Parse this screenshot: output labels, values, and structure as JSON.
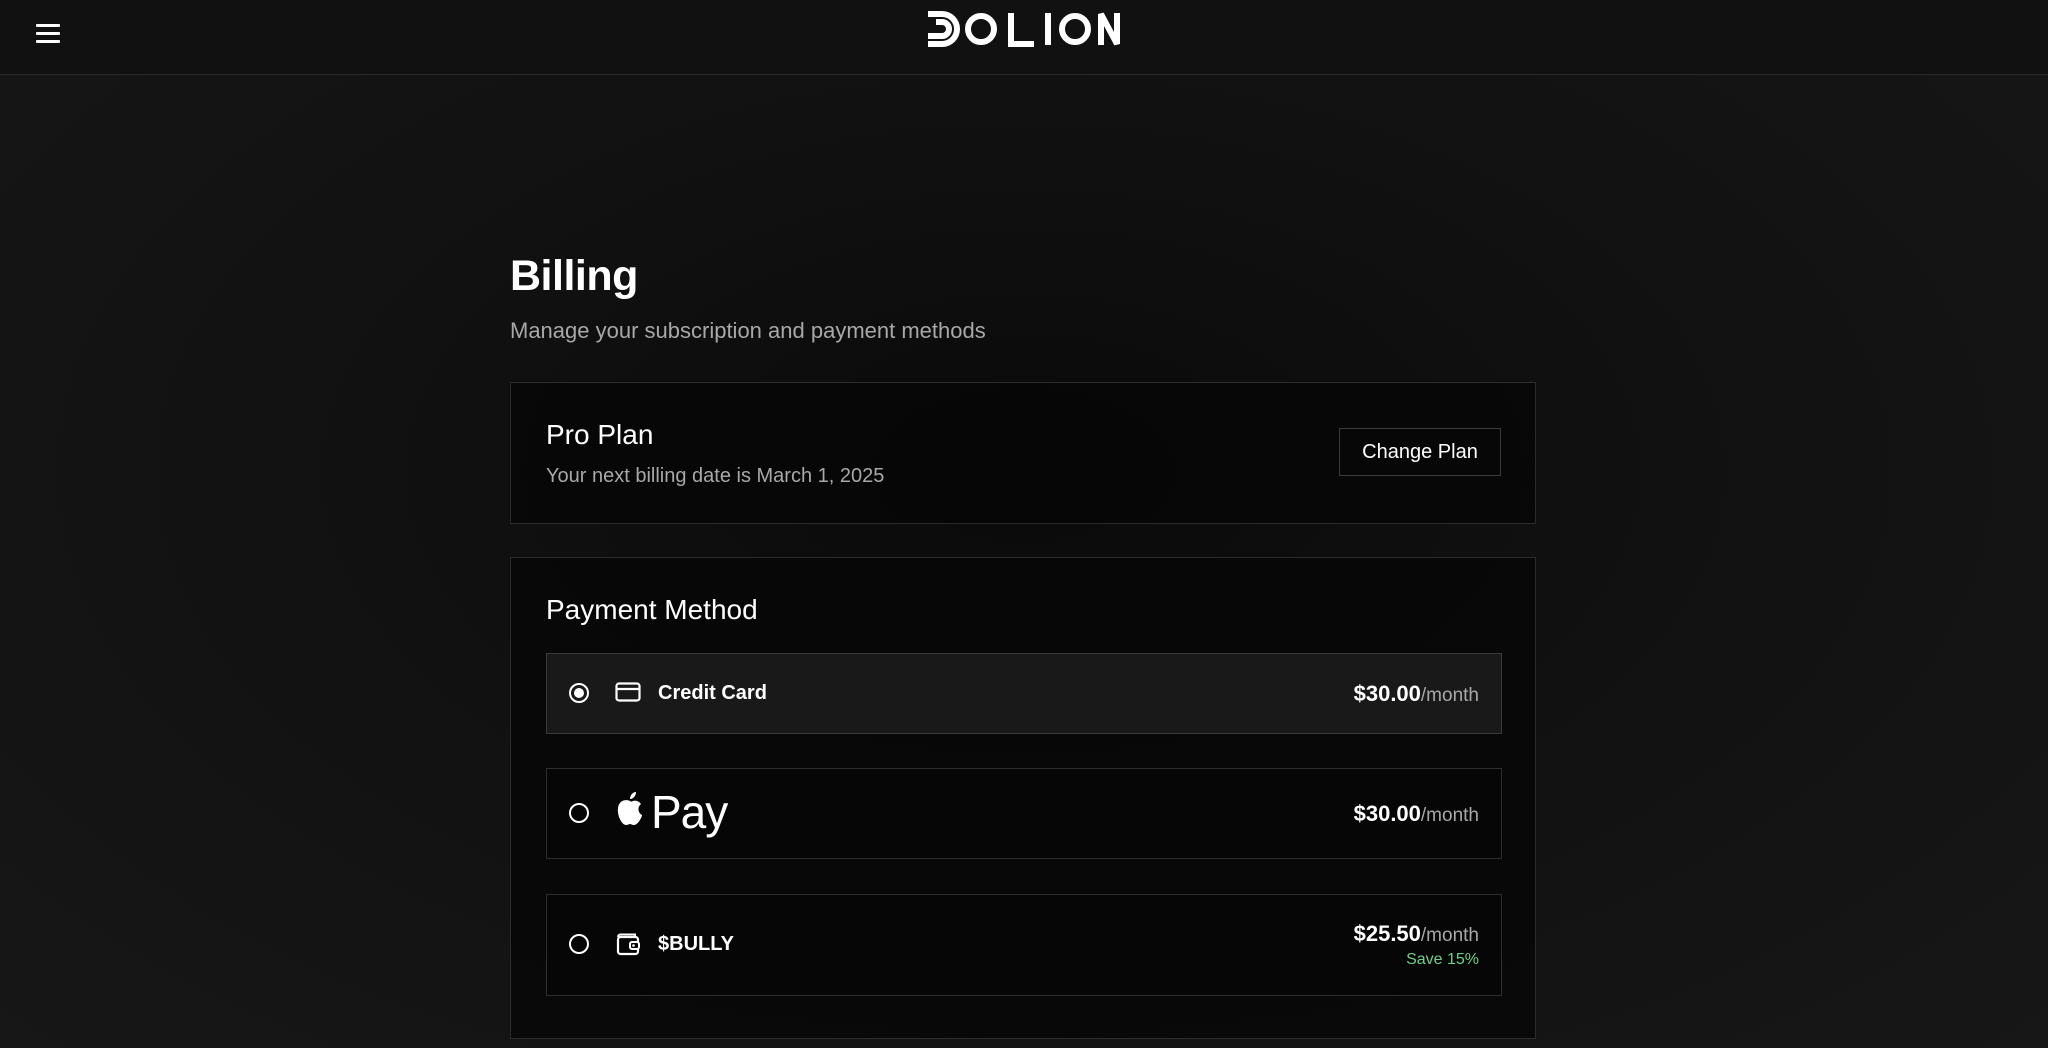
{
  "header": {
    "menu_icon": "hamburger-menu-icon",
    "logo": "DOLION"
  },
  "page": {
    "title": "Billing",
    "subtitle": "Manage your subscription and payment methods"
  },
  "plan": {
    "name": "Pro Plan",
    "billing_note": "Your next billing date is March 1, 2025",
    "change_button": "Change Plan"
  },
  "payment": {
    "title": "Payment Method",
    "options": [
      {
        "id": "credit-card",
        "label": "Credit Card",
        "icon": "credit-card-icon",
        "selected": true,
        "amount": "$30.00",
        "period": "/month"
      },
      {
        "id": "apple-pay",
        "label": "Pay",
        "icon": "apple-logo-icon",
        "selected": false,
        "amount": "$30.00",
        "period": "/month"
      },
      {
        "id": "bully",
        "label": "$BULLY",
        "icon": "wallet-icon",
        "selected": false,
        "amount": "$25.50",
        "period": "/month",
        "note": "Save 15%"
      }
    ]
  },
  "colors": {
    "background": "#111111",
    "card_border": "#2c2c2c",
    "muted_text": "#a8a8a8",
    "save_green": "#6fcf8a"
  }
}
